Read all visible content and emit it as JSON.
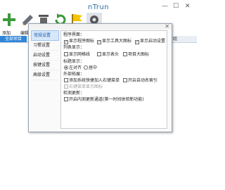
{
  "app": {
    "title": "nTrun"
  },
  "window_controls": {
    "minimize": "—",
    "maximize": "☐",
    "close": "✕"
  },
  "toolbar": {
    "add_label": "添加",
    "edit_label": "编辑"
  },
  "tabs": {
    "all": "全部项目"
  },
  "columns": {
    "group": "分组"
  },
  "colors": {
    "accent": "#2f86d6",
    "title": "#2e6da4"
  },
  "dialog": {
    "close_glyph": "✕",
    "nav": [
      "常规设置",
      "习惯设置",
      "启动设置",
      "按键设置",
      "高级设置"
    ],
    "sections": {
      "ui": "程序界面：",
      "list": "列表显示：",
      "title": "标题显示：",
      "ext": "外部拓展：",
      "update": "检测更新："
    },
    "options": {
      "show_tray": "显示程序图标",
      "show_toolbar": "显示工具大图标",
      "show_auto_mark": "显示启动设置",
      "show_grid": "显示网格线",
      "show_header": "显示表头",
      "big_icons": "项目大图标",
      "align_left": "左对齐",
      "align_center": "居中",
      "ctx_menu": "添加系统快捷加入右键菜单",
      "auto_start": "开启自动名索引",
      "ctx_icon": "右键菜单显示图标",
      "check_update": "开启内测更新通道(第一时间体验新功能)"
    }
  }
}
